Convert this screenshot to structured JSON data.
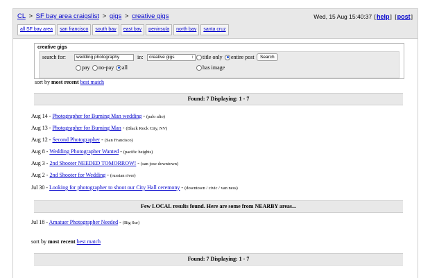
{
  "header": {
    "crumbs": [
      "CL",
      "SF bay area craigslist",
      "gigs",
      "creative gigs"
    ],
    "crumb_sep": ">",
    "timestamp": "Wed, 15 Aug 15:40:37",
    "help": "help",
    "post": "post"
  },
  "tabs": [
    "all SF bay area",
    "san francisco",
    "south bay",
    "east bay",
    "peninsula",
    "north bay",
    "santa cruz"
  ],
  "search": {
    "section_title": "creative gigs",
    "search_for_label": "search for:",
    "query": "wedding photography",
    "in_label": "in:",
    "category": "creative gigs",
    "opt_title_only": "title only",
    "opt_entire_post": "entire post",
    "button": "Search",
    "opt_pay": "pay",
    "opt_no_pay": "no-pay",
    "opt_all": "all",
    "opt_has_image": "has image"
  },
  "sort": {
    "prefix": "sort by",
    "current": "most recent",
    "alt": "best match"
  },
  "found_bar": "Found: 7 Displaying: 1 - 7",
  "listings": [
    {
      "date": "Aug 14",
      "title": "Photographer for Burning Man wedding",
      "location": "(palo alto)"
    },
    {
      "date": "Aug 13",
      "title": "Photographer for Burning Man",
      "location": "(Black Rock City, NV)"
    },
    {
      "date": "Aug 12",
      "title": "Second Photographer",
      "location": "(San Francisco)"
    },
    {
      "date": "Aug 8",
      "title": "Wedding Photographer Wanted",
      "location": "(pacific heights)"
    },
    {
      "date": "Aug 3",
      "title": "2nd Shooter NEEDED TOMORROW!",
      "location": "(san jose downtown)"
    },
    {
      "date": "Aug 2",
      "title": "2nd Shooter for Wedding",
      "location": "(russian river)"
    },
    {
      "date": "Jul 30",
      "title": "Looking for photographer to shoot our City Hall ceremony",
      "location": "(downtown / civic / van ness)"
    }
  ],
  "nearby_bar": "Few LOCAL results found. Here are some from NEARBY areas...",
  "nearby": [
    {
      "date": "Jul 18",
      "title": "Amatuer Photographer Needed",
      "location": "(Big Sur)"
    }
  ]
}
